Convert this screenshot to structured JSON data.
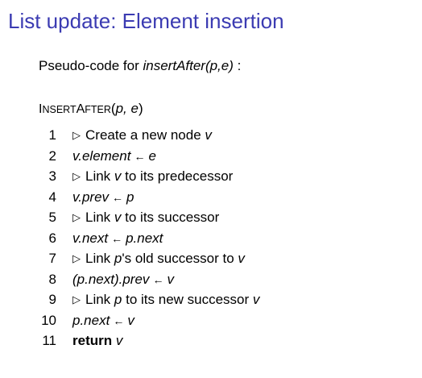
{
  "title": "List update: Element insertion",
  "intro": {
    "prefix": "Pseudo-code for ",
    "function": "insertAfter(p,e)",
    "suffix": " :"
  },
  "algorithm": {
    "name_part1_big": "I",
    "name_part1_small": "NSERT",
    "name_part2_big": "A",
    "name_part2_small": "FTER",
    "open_paren": "(",
    "params": "p, e",
    "close_paren": ")"
  },
  "lines": [
    {
      "num": "1",
      "comment": "Create a new node ",
      "var": "v"
    },
    {
      "num": "2",
      "lhs": "v.element",
      "arrow": "←",
      "rhs": "e"
    },
    {
      "num": "3",
      "comment_a": "Link ",
      "var": "v",
      "comment_b": " to its predecessor"
    },
    {
      "num": "4",
      "lhs": "v.prev",
      "arrow": "←",
      "rhs": "p"
    },
    {
      "num": "5",
      "comment_a": "Link ",
      "var": "v",
      "comment_b": " to its successor"
    },
    {
      "num": "6",
      "lhs": "v.next",
      "arrow": "←",
      "rhs": "p.next"
    },
    {
      "num": "7",
      "comment_a": "Link ",
      "var": "p",
      "comment_b": "'s old successor to ",
      "var2": "v"
    },
    {
      "num": "8",
      "lhs": "(p.next).prev",
      "arrow": "←",
      "rhs": "v"
    },
    {
      "num": "9",
      "comment_a": "Link ",
      "var": "p",
      "comment_b": " to its new successor ",
      "var2": "v"
    },
    {
      "num": "10",
      "lhs": "p.next",
      "arrow": "←",
      "rhs": "v"
    },
    {
      "num": "11",
      "keyword": "return",
      "var": "v"
    }
  ],
  "comment_marker": "▷",
  "colors": {
    "title": "#3b3bb2",
    "text": "#000000",
    "background": "#ffffff"
  }
}
